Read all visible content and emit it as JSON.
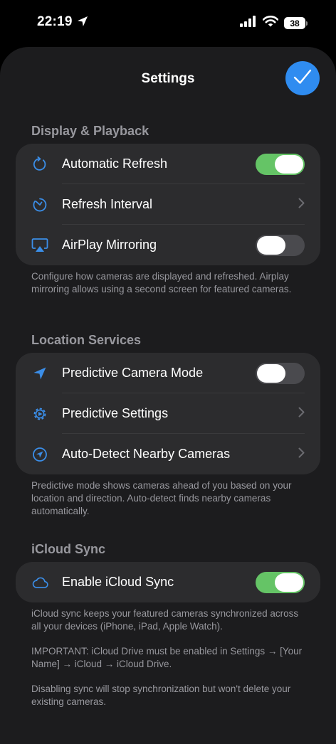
{
  "status_bar": {
    "time": "22:19",
    "battery": "38"
  },
  "sheet": {
    "title": "Settings"
  },
  "sections": {
    "display": {
      "header": "Display & Playback",
      "rows": {
        "auto_refresh": {
          "label": "Automatic Refresh",
          "toggle": true
        },
        "refresh_interval": {
          "label": "Refresh Interval"
        },
        "airplay": {
          "label": "AirPlay Mirroring",
          "toggle": false
        }
      },
      "footer": "Configure how cameras are displayed and refreshed. Airplay mirroring allows using a second screen for featured cameras."
    },
    "location": {
      "header": "Location Services",
      "rows": {
        "predictive_mode": {
          "label": "Predictive Camera Mode",
          "toggle": false
        },
        "predictive_settings": {
          "label": "Predictive Settings"
        },
        "auto_detect": {
          "label": "Auto-Detect Nearby Cameras"
        }
      },
      "footer": "Predictive mode shows cameras ahead of you based on your location and direction. Auto-detect finds nearby cameras automatically."
    },
    "icloud": {
      "header": "iCloud Sync",
      "rows": {
        "enable_sync": {
          "label": "Enable iCloud Sync",
          "toggle": true
        }
      },
      "footer": [
        "iCloud sync keeps your featured cameras synchronized across all your devices (iPhone, iPad, Apple Watch).",
        "IMPORTANT: iCloud Drive must be enabled in Settings → [Your Name] → iCloud → iCloud Drive.",
        "Disabling sync will stop synchronization but won't delete your existing cameras."
      ]
    }
  },
  "colors": {
    "accent": "#2f8cf0",
    "toggle_on": "#65c466",
    "toggle_off": "#4a4a4e"
  }
}
